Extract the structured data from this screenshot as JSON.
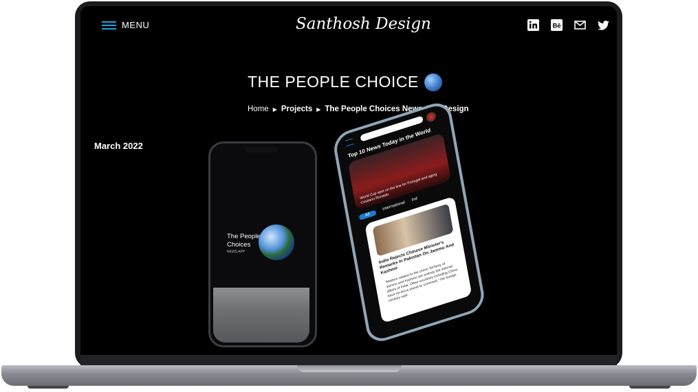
{
  "header": {
    "menu_label": "MENU",
    "logo": "Santhosh Design",
    "social": [
      {
        "icon": "linkedin-icon"
      },
      {
        "icon": "behance-icon",
        "text": "Bē"
      },
      {
        "icon": "mail-icon"
      },
      {
        "icon": "twitter-icon"
      }
    ]
  },
  "page": {
    "title": "THE PEOPLE CHOICE",
    "breadcrumb": {
      "home": "Home",
      "projects": "Projects",
      "current": "The People Choices News App Design"
    },
    "date": "March 2022"
  },
  "mockup": {
    "phone1": {
      "title": "The People Choices",
      "subtitle": "NEWS APP"
    },
    "phone2": {
      "headline": "Top 10 News Today in the World",
      "hero_caption": "World Cup spot on the line for Portugal and aging Cristiano Ronaldo",
      "tabs": [
        "All",
        "International",
        "Ind"
      ],
      "card_title": "India Rejects Chinese Minister's Remarks In Pakistan On Jammu And Kashmir",
      "card_body": "\"Matters related to the Union Territory of Jammu and Kashmir are entirely the internal affairs of India. Other countries including China have no locus standi to comment,\" the foreign ministry said."
    }
  },
  "colors": {
    "accent": "#19a3e0",
    "background": "#000000",
    "tab_active": "#1f7ad1"
  }
}
